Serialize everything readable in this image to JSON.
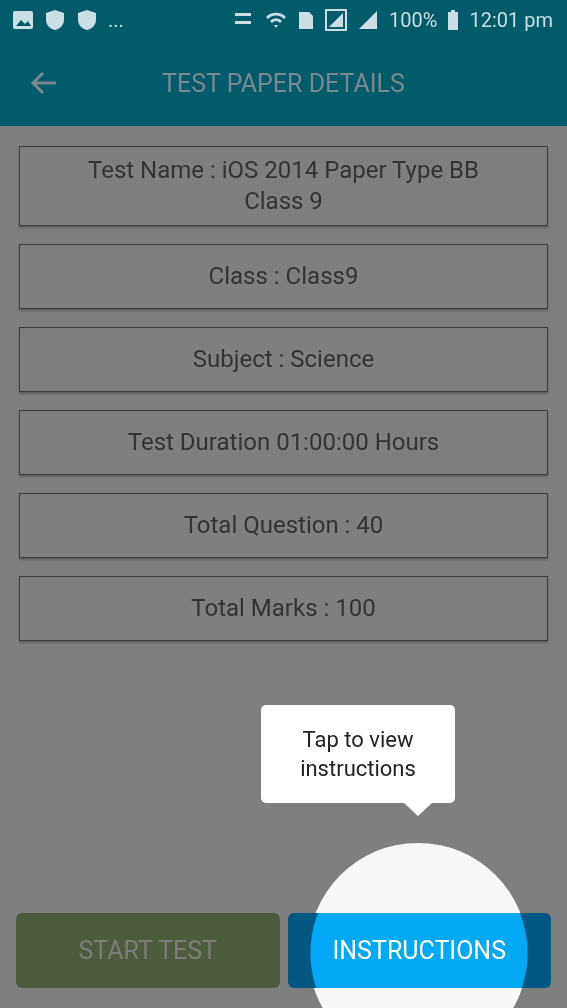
{
  "status_bar": {
    "overflow": "...",
    "battery": "100%",
    "time": "12:01 pm"
  },
  "app_bar": {
    "title": "TEST PAPER DETAILS"
  },
  "details": [
    {
      "text": "Test Name : iOS 2014 Paper Type BB Class 9"
    },
    {
      "text": "Class : Class9"
    },
    {
      "text": "Subject : Science"
    },
    {
      "text": "Test Duration 01:00:00 Hours"
    },
    {
      "text": "Total Question : 40"
    },
    {
      "text": "Total Marks : 100"
    }
  ],
  "tooltip": {
    "text": "Tap to view instructions"
  },
  "buttons": [
    {
      "label": "START TEST",
      "kind": "plain"
    },
    {
      "label": "INSTRUCTIONS",
      "kind": "spotlit"
    }
  ]
}
